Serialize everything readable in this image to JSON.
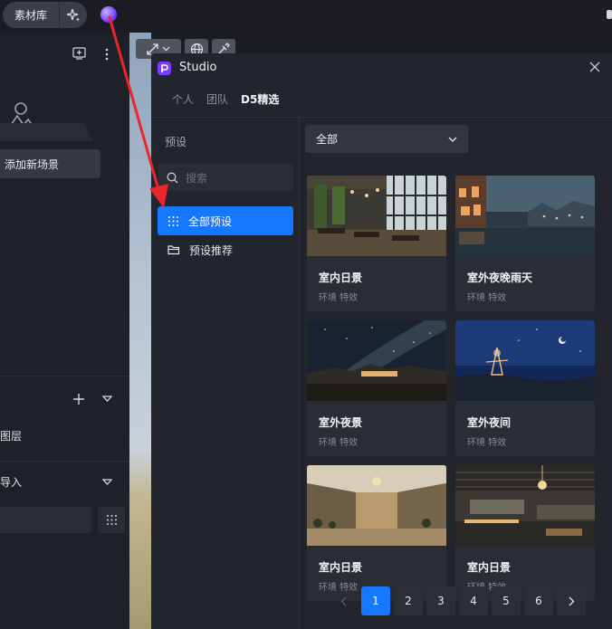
{
  "topbar": {
    "library_label": "素材库"
  },
  "left_panel": {
    "add_scene_label": "添加新场景",
    "layers_label": "图层",
    "import_label": "导入"
  },
  "dialog": {
    "title": "Studio",
    "tabs": [
      {
        "label": "个人",
        "active": false
      },
      {
        "label": "团队",
        "active": false
      },
      {
        "label": "D5精选",
        "active": true
      }
    ],
    "sidebar": {
      "title": "预设",
      "search_placeholder": "搜索",
      "items": [
        {
          "label": "全部预设",
          "active": true,
          "icon": "grid-icon"
        },
        {
          "label": "预设推荐",
          "active": false,
          "icon": "folder-icon"
        }
      ]
    },
    "filter": {
      "selected": "全部"
    },
    "cards": [
      {
        "name": "室内日景",
        "tag": "环境 特效",
        "icon": "interior-day-thumbnail"
      },
      {
        "name": "室外夜晚雨天",
        "tag": "环境 特效",
        "icon": "exterior-rainy-night-thumbnail"
      },
      {
        "name": "室外夜景",
        "tag": "环境 特效",
        "icon": "exterior-night-milkyway-thumbnail"
      },
      {
        "name": "室外夜间",
        "tag": "环境 特效",
        "icon": "exterior-night-tower-thumbnail"
      },
      {
        "name": "室内日景",
        "tag": "环境 特效",
        "icon": "interior-lobby-thumbnail"
      },
      {
        "name": "室内日景",
        "tag": "环境 特效",
        "icon": "interior-lounge-thumbnail"
      }
    ],
    "pagination": {
      "pages": [
        "1",
        "2",
        "3",
        "4",
        "5",
        "6"
      ],
      "current": "1"
    }
  },
  "colors": {
    "accent": "#1677ff",
    "annotation_arrow": "#e8262b",
    "brand_logo": "#7a3cff"
  }
}
